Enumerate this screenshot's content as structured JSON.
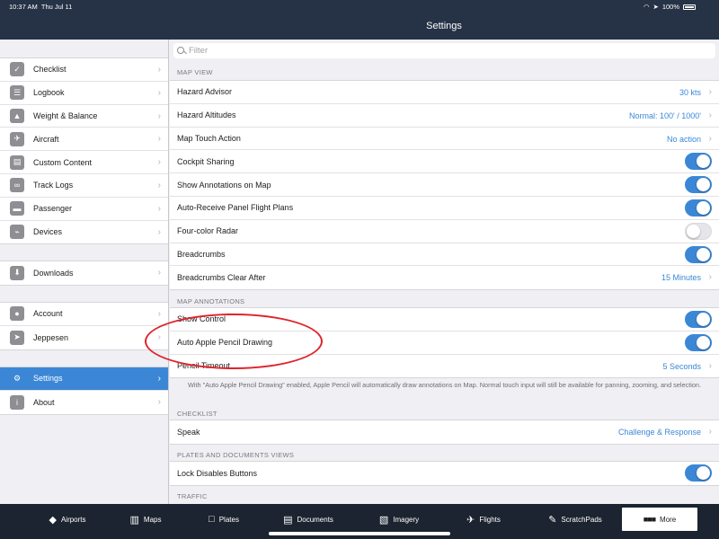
{
  "status_bar": {
    "time": "10:37 AM",
    "date": "Thu Jul 11",
    "battery": "100%",
    "wifi_icon": "wifi-icon",
    "location_icon": "location-arrow-icon"
  },
  "nav": {
    "title": "Settings"
  },
  "colors": {
    "accent": "#3b87d6",
    "nav_bg": "#263346",
    "tabbar_bg": "#1b2430",
    "annotation": "#e0222a"
  },
  "sidebar": {
    "groups": [
      [
        {
          "label": "Checklist",
          "icon": "check-icon"
        },
        {
          "label": "Logbook",
          "icon": "book-icon"
        },
        {
          "label": "Weight & Balance",
          "icon": "weight-icon"
        },
        {
          "label": "Aircraft",
          "icon": "airplane-icon"
        },
        {
          "label": "Custom Content",
          "icon": "custom-content-icon"
        },
        {
          "label": "Track Logs",
          "icon": "track-log-icon"
        },
        {
          "label": "Passenger",
          "icon": "seat-icon"
        },
        {
          "label": "Devices",
          "icon": "plug-icon"
        }
      ],
      [
        {
          "label": "Downloads",
          "icon": "download-icon"
        }
      ],
      [
        {
          "label": "Account",
          "icon": "person-icon"
        },
        {
          "label": "Jeppesen",
          "icon": "jeppesen-icon"
        }
      ],
      [
        {
          "label": "Settings",
          "icon": "gear-icon",
          "active": true
        },
        {
          "label": "About",
          "icon": "info-icon"
        }
      ]
    ]
  },
  "filter": {
    "placeholder": "Filter",
    "value": ""
  },
  "sections": {
    "map_view": {
      "header": "MAP VIEW",
      "rows": [
        {
          "label": "Hazard Advisor",
          "value": "30 kts"
        },
        {
          "label": "Hazard Altitudes",
          "value": "Normal: 100' / 1000'"
        },
        {
          "label": "Map Touch Action",
          "value": "No action"
        },
        {
          "label": "Cockpit Sharing",
          "toggle": true
        },
        {
          "label": "Show Annotations on Map",
          "toggle": true
        },
        {
          "label": "Auto-Receive Panel Flight Plans",
          "toggle": true
        },
        {
          "label": "Four-color Radar",
          "toggle": false
        },
        {
          "label": "Breadcrumbs",
          "toggle": true
        },
        {
          "label": "Breadcrumbs Clear After",
          "value": "15 Minutes"
        }
      ]
    },
    "map_annotations": {
      "header": "MAP ANNOTATIONS",
      "rows": [
        {
          "label": "Show Control",
          "toggle": true
        },
        {
          "label": "Auto Apple Pencil Drawing",
          "toggle": true
        },
        {
          "label": "Pencil Timeout",
          "value": "5 Seconds"
        }
      ],
      "footer": "With \"Auto Apple Pencil Drawing\" enabled, Apple Pencil will automatically draw annotations on Map. Normal touch input will still be available for panning, zooming, and selection."
    },
    "checklist": {
      "header": "CHECKLIST",
      "rows": [
        {
          "label": "Speak",
          "value": "Challenge & Response"
        }
      ]
    },
    "plates": {
      "header": "PLATES AND DOCUMENTS VIEWS",
      "rows": [
        {
          "label": "Lock Disables Buttons",
          "toggle": true
        }
      ]
    },
    "traffic": {
      "header": "TRAFFIC"
    }
  },
  "tabbar": {
    "tabs": [
      {
        "label": "Airports",
        "icon": "airport-icon"
      },
      {
        "label": "Maps",
        "icon": "map-icon"
      },
      {
        "label": "Plates",
        "icon": "plates-icon"
      },
      {
        "label": "Documents",
        "icon": "documents-icon"
      },
      {
        "label": "Imagery",
        "icon": "imagery-icon"
      },
      {
        "label": "Flights",
        "icon": "flights-icon"
      },
      {
        "label": "ScratchPads",
        "icon": "pencil-icon"
      },
      {
        "label": "More",
        "icon": "more-icon",
        "active": true
      }
    ]
  }
}
